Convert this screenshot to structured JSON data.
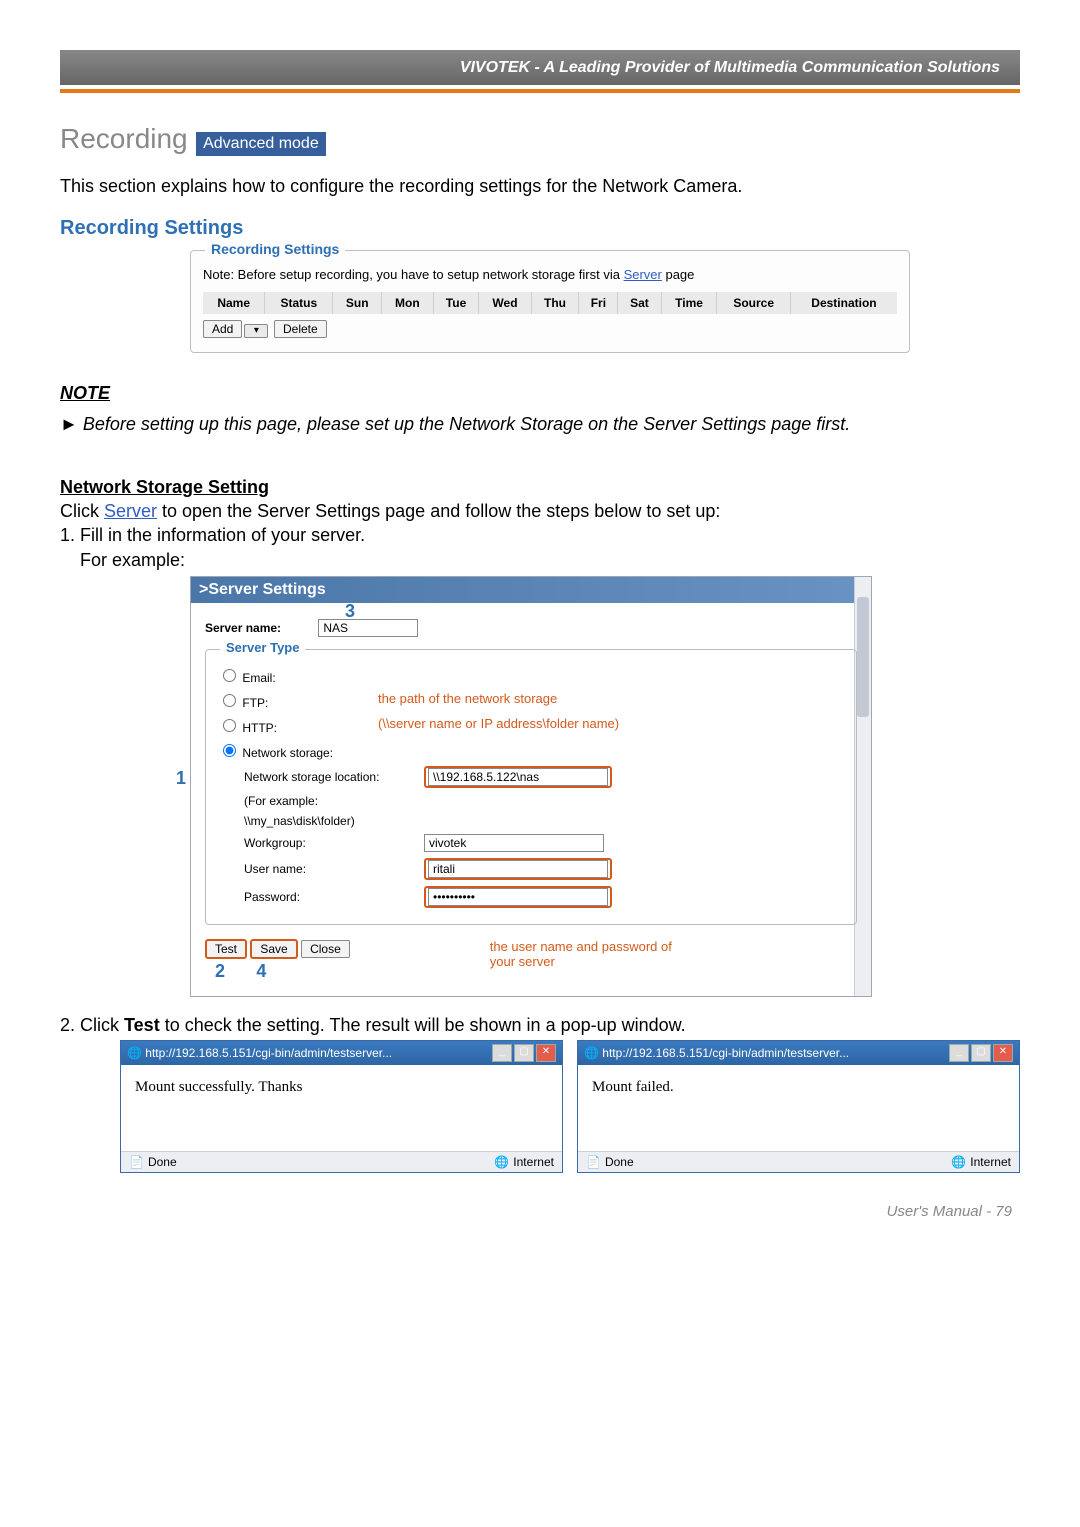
{
  "header": {
    "brand": "VIVOTEK - A Leading Provider of Multimedia Communication Solutions"
  },
  "title": {
    "main": "Recording",
    "badge": "Advanced mode"
  },
  "intro": "This section explains how to configure the recording settings for the Network Camera.",
  "sub_heading": "Recording Settings",
  "rec_fieldset": {
    "legend": "Recording Settings",
    "note_prefix": "Note: Before setup recording, you have to setup network storage first via ",
    "note_link": "Server",
    "note_suffix": " page",
    "columns": [
      "Name",
      "Status",
      "Sun",
      "Mon",
      "Tue",
      "Wed",
      "Thu",
      "Fri",
      "Sat",
      "Time",
      "Source",
      "Destination"
    ],
    "add_btn": "Add",
    "delete_btn": "Delete"
  },
  "note_section": {
    "heading": "NOTE",
    "body": "► Before setting up this page, please set up the Network Storage on the Server Settings page first."
  },
  "net_storage": {
    "heading": "Network Storage Setting",
    "line1_pre": "Click ",
    "line1_link": "Server",
    "line1_post": " to open the Server Settings page and follow the steps below to set up:",
    "line2": "1. Fill in the information of your server.",
    "line3": "    For example:"
  },
  "server_panel": {
    "header": ">Server Settings",
    "server_name_label": "Server name:",
    "server_name_value": "NAS",
    "annot_3": "3",
    "server_type_legend": "Server Type",
    "email": "Email:",
    "ftp": "FTP:",
    "http": "HTTP:",
    "path_annot1": "the path of the network storage",
    "path_annot2": "(\\\\server name or IP address\\folder name)",
    "annot_1": "1",
    "ns_label": "Network storage:",
    "loc_label": "Network storage location:",
    "loc_value": "\\\\192.168.5.122\\nas",
    "eg1": "(For example:",
    "eg2": "\\\\my_nas\\disk\\folder)",
    "wg_label": "Workgroup:",
    "wg_value": "vivotek",
    "un_label": "User name:",
    "un_value": "ritali",
    "pw_label": "Password:",
    "pw_value": "••••••••••",
    "user_pw_annot1": "the user name and password of",
    "user_pw_annot2": "your server",
    "test_btn": "Test",
    "save_btn": "Save",
    "close_btn": "Close",
    "annot_2": "2",
    "annot_4": "4"
  },
  "step2": {
    "pre": "2. Click ",
    "bold": "Test",
    "post": " to check the setting. The result will be shown in a pop-up window."
  },
  "popups": {
    "title": "http://192.168.5.151/cgi-bin/admin/testserver...",
    "success_msg": "Mount successfully. Thanks",
    "fail_msg": "Mount failed.",
    "done": "Done",
    "internet": "Internet"
  },
  "footer": "User's Manual - 79"
}
